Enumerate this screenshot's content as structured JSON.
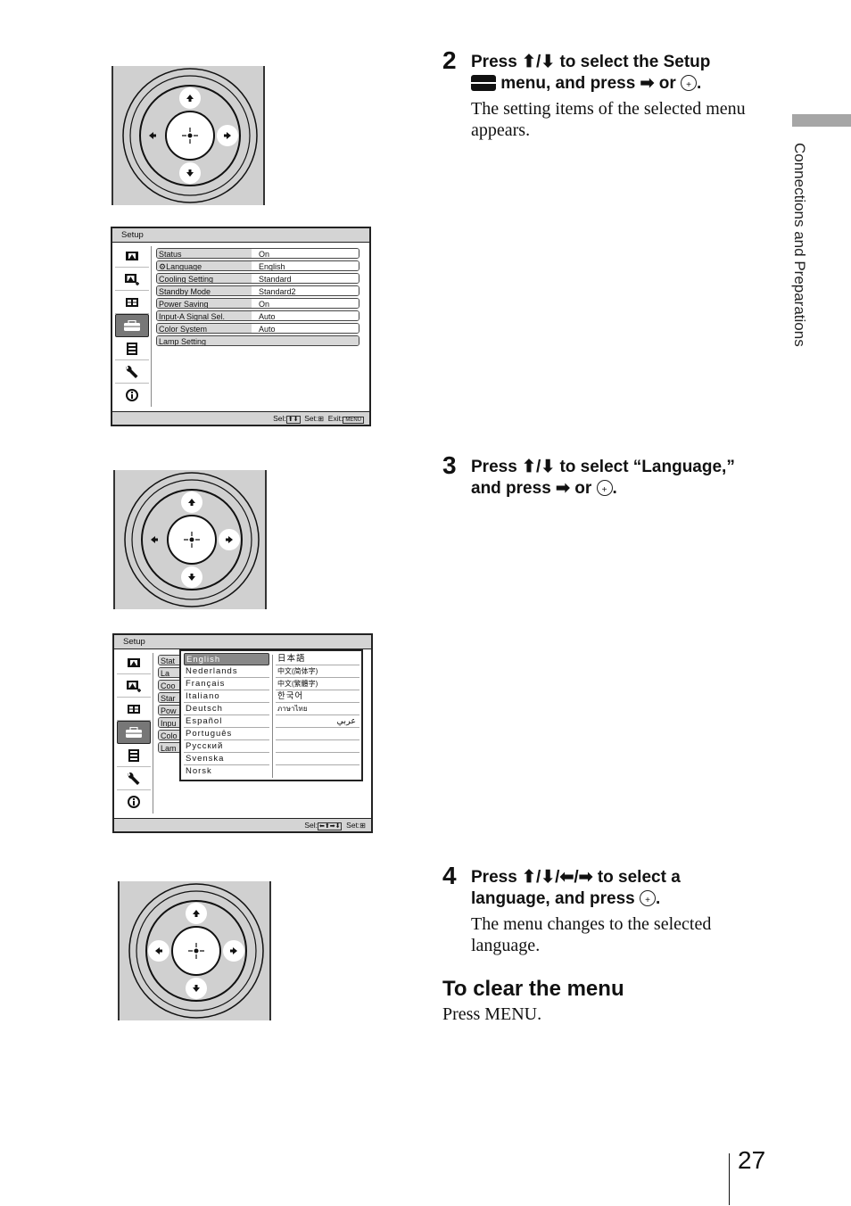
{
  "sidebar": {
    "section_label": "Connections and Preparations"
  },
  "page_number": "27",
  "remote_pads": [
    {
      "highlighted": [
        "up",
        "down",
        "right"
      ]
    },
    {
      "highlighted": [
        "up",
        "down",
        "right"
      ]
    },
    {
      "highlighted": [
        "up",
        "down",
        "left",
        "right"
      ]
    }
  ],
  "osd1": {
    "title": "Setup",
    "icons": [
      "picture-icon",
      "picture-adjust-icon",
      "screen-icon",
      "setup-toolbox-icon",
      "menu-list-icon",
      "wrench-icon",
      "info-icon"
    ],
    "selected_icon": "setup-toolbox-icon",
    "rows": [
      {
        "label": "Status",
        "value": "On"
      },
      {
        "label": "Language",
        "value": "English"
      },
      {
        "label": "Cooling Setting",
        "value": "Standard"
      },
      {
        "label": "Standby Mode",
        "value": "Standard2"
      },
      {
        "label": "Power Saving",
        "value": "On"
      },
      {
        "label": "Input-A Signal Sel.",
        "value": "Auto"
      },
      {
        "label": "Color System",
        "value": "Auto"
      },
      {
        "label": "Lamp Setting",
        "value": ""
      }
    ],
    "footer": {
      "sel": "Sel:",
      "set": "Set:",
      "exit": "Exit:",
      "menu_key": "MENU"
    }
  },
  "osd2": {
    "title": "Setup",
    "rows_truncated": [
      "Stat",
      "La",
      "Coo",
      "Star",
      "Pow",
      "Inpu",
      "Colo",
      "Lam"
    ],
    "languages_col1": [
      "English",
      "Nederlands",
      "Français",
      "Italiano",
      "Deutsch",
      "Español",
      "Português",
      "Русский",
      "Svenska",
      "Norsk"
    ],
    "languages_col2": [
      "日本語",
      "中文(简体字)",
      "中文(繁體字)",
      "한국어",
      "ภาษาไทย",
      "عربي",
      "",
      "",
      "",
      ""
    ],
    "selected_language": "English",
    "footer": {
      "sel": "Sel:",
      "set": "Set:"
    }
  },
  "steps": [
    {
      "number": "2",
      "line1": "Press ⬆/⬇ to select the Setup",
      "line2": " menu, and press ➡ or ",
      "body": "The setting items of the selected menu appears."
    },
    {
      "number": "3",
      "line1": "Press ⬆/⬇ to select “Language,”",
      "line2": "and press ➡ or ",
      "body": ""
    },
    {
      "number": "4",
      "line1": "Press ⬆/⬇/⬅/➡ to select a",
      "line2": "language, and press ",
      "body": "The menu changes to the selected language."
    }
  ],
  "clear_menu": {
    "heading": "To clear the menu",
    "body": "Press MENU."
  }
}
